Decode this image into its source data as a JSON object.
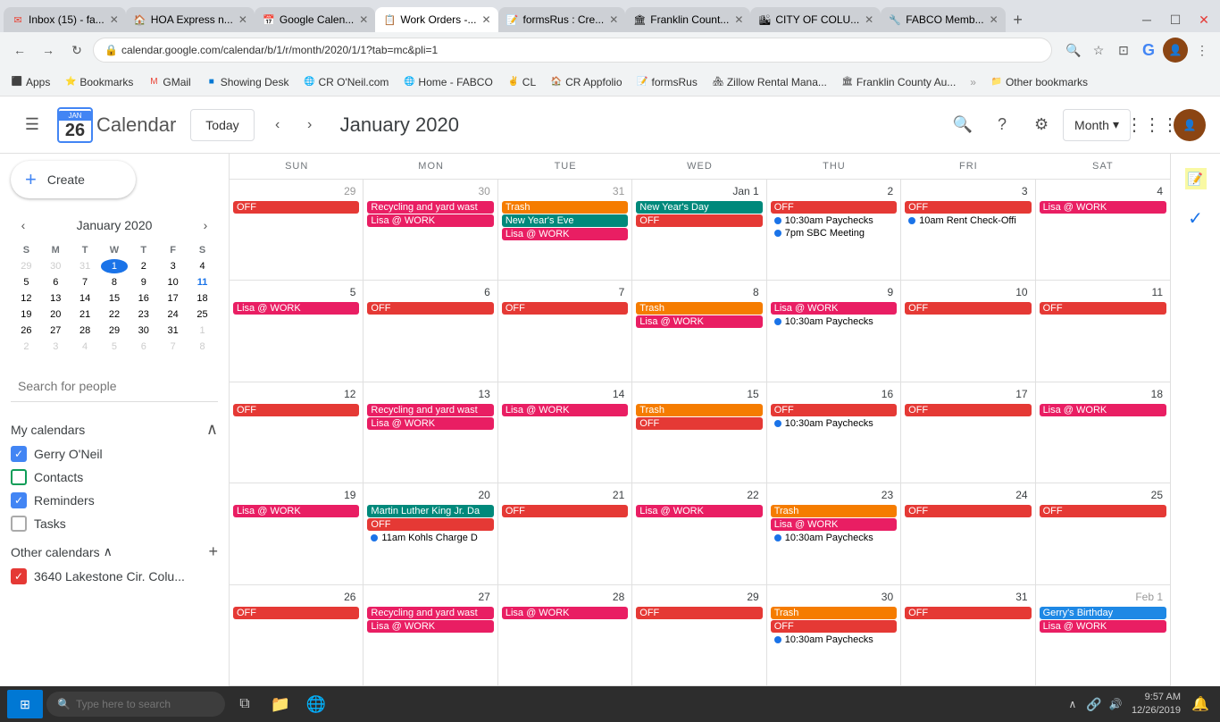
{
  "browser": {
    "tabs": [
      {
        "id": "gmail",
        "label": "Inbox (15) - fa...",
        "favicon": "✉",
        "active": false,
        "color": "#EA4335"
      },
      {
        "id": "hoa",
        "label": "HOA Express n...",
        "favicon": "🏠",
        "active": false
      },
      {
        "id": "gcal",
        "label": "Google Calen...",
        "favicon": "📅",
        "active": false
      },
      {
        "id": "workorders",
        "label": "Work Orders -...",
        "favicon": "📋",
        "active": true
      },
      {
        "id": "formsrus",
        "label": "formsRus : Cre...",
        "favicon": "📝",
        "active": false
      },
      {
        "id": "franklin1",
        "label": "Franklin Count...",
        "favicon": "🏛",
        "active": false
      },
      {
        "id": "cityofcolu",
        "label": "CITY OF COLU...",
        "favicon": "🏙",
        "active": false
      },
      {
        "id": "fabco",
        "label": "FABCO Memb...",
        "favicon": "🔧",
        "active": false
      }
    ],
    "address": "calendar.google.com/calendar/b/1/r/month/2020/1/1?tab=mc&pli=1",
    "bookmarks": [
      {
        "label": "Apps",
        "favicon": "⬛"
      },
      {
        "label": "Bookmarks",
        "favicon": "⭐"
      },
      {
        "label": "GMail",
        "favicon": "✉"
      },
      {
        "label": "Showing Desk",
        "favicon": "🟦"
      },
      {
        "label": "CR O'Neil.com",
        "favicon": "🌐"
      },
      {
        "label": "Home - FABCO",
        "favicon": "🌐"
      },
      {
        "label": "CL",
        "favicon": "✌"
      },
      {
        "label": "CR Appfolio",
        "favicon": "🏠"
      },
      {
        "label": "formsRus",
        "favicon": "📝"
      },
      {
        "label": "Zillow Rental Mana...",
        "favicon": "🏘"
      },
      {
        "label": "Franklin County Au...",
        "favicon": "🏛"
      },
      {
        "label": "Other bookmarks",
        "favicon": "📁"
      }
    ]
  },
  "header": {
    "logo_num": "26",
    "calendar_text": "Calendar",
    "today_label": "Today",
    "month_title": "January 2020",
    "view_label": "Month",
    "search_tooltip": "Search",
    "help_tooltip": "Help",
    "settings_tooltip": "Settings"
  },
  "sidebar": {
    "create_label": "Create",
    "mini_cal": {
      "title": "January 2020",
      "days_of_week": [
        "S",
        "M",
        "T",
        "W",
        "T",
        "F",
        "S"
      ],
      "weeks": [
        [
          {
            "num": "29",
            "other": true
          },
          {
            "num": "30",
            "other": true
          },
          {
            "num": "31",
            "other": true
          },
          {
            "num": "1",
            "today": true
          },
          {
            "num": "2"
          },
          {
            "num": "3"
          },
          {
            "num": "4"
          }
        ],
        [
          {
            "num": "5"
          },
          {
            "num": "6"
          },
          {
            "num": "7"
          },
          {
            "num": "8"
          },
          {
            "num": "9"
          },
          {
            "num": "10"
          },
          {
            "num": "11",
            "highlight": true
          }
        ],
        [
          {
            "num": "12"
          },
          {
            "num": "13"
          },
          {
            "num": "14"
          },
          {
            "num": "15"
          },
          {
            "num": "16"
          },
          {
            "num": "17"
          },
          {
            "num": "18"
          }
        ],
        [
          {
            "num": "19"
          },
          {
            "num": "20"
          },
          {
            "num": "21"
          },
          {
            "num": "22"
          },
          {
            "num": "23"
          },
          {
            "num": "24"
          },
          {
            "num": "25"
          }
        ],
        [
          {
            "num": "26"
          },
          {
            "num": "27"
          },
          {
            "num": "28"
          },
          {
            "num": "29"
          },
          {
            "num": "30"
          },
          {
            "num": "31"
          },
          {
            "num": "1",
            "other": true
          }
        ],
        [
          {
            "num": "2",
            "other": true
          },
          {
            "num": "3",
            "other": true
          },
          {
            "num": "4",
            "other": true
          },
          {
            "num": "5",
            "other": true
          },
          {
            "num": "6",
            "other": true
          },
          {
            "num": "7",
            "other": true
          },
          {
            "num": "8",
            "other": true
          }
        ]
      ]
    },
    "search_people_placeholder": "Search for people",
    "my_calendars_label": "My calendars",
    "my_calendars": [
      {
        "label": "Gerry O'Neil",
        "color": "#4285f4",
        "checked": true
      },
      {
        "label": "Contacts",
        "color": "#fff",
        "checked": false,
        "border": "#0f9d58"
      },
      {
        "label": "Reminders",
        "color": "#4285f4",
        "checked": true
      },
      {
        "label": "Tasks",
        "color": "#fff",
        "checked": false,
        "border": "#aaa"
      }
    ],
    "other_calendars_label": "Other calendars",
    "other_calendars": [
      {
        "label": "3640 Lakestone Cir. Colu...",
        "color": "#e53935",
        "checked": true
      }
    ]
  },
  "calendar": {
    "days_of_week": [
      "SUN",
      "MON",
      "TUE",
      "WED",
      "THU",
      "FRI",
      "SAT"
    ],
    "weeks": [
      {
        "days": [
          {
            "num": "29",
            "other": true,
            "events": [
              {
                "text": "OFF",
                "color": "red"
              }
            ]
          },
          {
            "num": "30",
            "other": true,
            "events": [
              {
                "text": "Recycling and yard wast",
                "color": "pink"
              },
              {
                "text": "Lisa @ WORK",
                "color": "pink"
              }
            ]
          },
          {
            "num": "31",
            "other": true,
            "events": [
              {
                "text": "Trash",
                "color": "orange"
              },
              {
                "text": "New Year's Eve",
                "color": "teal"
              },
              {
                "text": "Lisa @ WORK",
                "color": "pink"
              }
            ]
          },
          {
            "num": "Jan 1",
            "today": false,
            "events": [
              {
                "text": "New Year's Day",
                "color": "teal"
              }
            ]
          },
          {
            "num": "2",
            "events": [
              {
                "text": "OFF",
                "color": "red"
              },
              {
                "dot": true,
                "text": "10:30am Paychecks",
                "color": "blue"
              },
              {
                "dot": true,
                "text": "7pm SBC Meeting",
                "color": "blue"
              }
            ]
          },
          {
            "num": "3",
            "events": [
              {
                "text": "OFF",
                "color": "red"
              },
              {
                "dot": true,
                "text": "10am Rent Check-Offi",
                "color": "blue"
              }
            ]
          },
          {
            "num": "4",
            "events": [
              {
                "text": "Lisa @ WORK",
                "color": "pink"
              }
            ]
          }
        ]
      },
      {
        "days": [
          {
            "num": "5",
            "events": [
              {
                "text": "Lisa @ WORK",
                "color": "pink"
              }
            ]
          },
          {
            "num": "6",
            "events": [
              {
                "text": "OFF",
                "color": "red"
              }
            ]
          },
          {
            "num": "7",
            "events": [
              {
                "text": "OFF",
                "color": "red"
              }
            ]
          },
          {
            "num": "8",
            "events": [
              {
                "text": "Trash",
                "color": "orange"
              },
              {
                "text": "Lisa @ WORK",
                "color": "pink"
              }
            ]
          },
          {
            "num": "9",
            "events": [
              {
                "text": "Lisa @ WORK",
                "color": "pink"
              },
              {
                "dot": true,
                "text": "10:30am Paychecks",
                "color": "blue"
              }
            ]
          },
          {
            "num": "10",
            "events": [
              {
                "text": "OFF",
                "color": "red"
              }
            ]
          },
          {
            "num": "11",
            "events": [
              {
                "text": "OFF",
                "color": "red"
              }
            ]
          }
        ]
      },
      {
        "days": [
          {
            "num": "12",
            "events": [
              {
                "text": "OFF",
                "color": "red"
              }
            ]
          },
          {
            "num": "13",
            "events": [
              {
                "text": "Recycling and yard wast",
                "color": "pink"
              },
              {
                "text": "Lisa @ WORK",
                "color": "pink"
              }
            ]
          },
          {
            "num": "14",
            "events": [
              {
                "text": "Lisa @ WORK",
                "color": "pink"
              }
            ]
          },
          {
            "num": "15",
            "events": [
              {
                "text": "Trash",
                "color": "orange"
              },
              {
                "text": "OFF",
                "color": "red"
              }
            ]
          },
          {
            "num": "16",
            "events": [
              {
                "text": "OFF",
                "color": "red"
              },
              {
                "dot": true,
                "text": "10:30am Paychecks",
                "color": "blue"
              }
            ]
          },
          {
            "num": "17",
            "events": [
              {
                "text": "OFF",
                "color": "red"
              }
            ]
          },
          {
            "num": "18",
            "events": [
              {
                "text": "Lisa @ WORK",
                "color": "pink"
              }
            ]
          }
        ]
      },
      {
        "days": [
          {
            "num": "19",
            "events": [
              {
                "text": "Lisa @ WORK",
                "color": "pink"
              }
            ]
          },
          {
            "num": "20",
            "events": [
              {
                "text": "Martin Luther King Jr. Da",
                "color": "teal"
              },
              {
                "text": "OFF",
                "color": "red"
              },
              {
                "dot": true,
                "text": "11am Kohls Charge D",
                "color": "blue"
              }
            ]
          },
          {
            "num": "21",
            "events": [
              {
                "text": "OFF",
                "color": "red"
              }
            ]
          },
          {
            "num": "22",
            "events": [
              {
                "text": "Lisa @ WORK",
                "color": "pink"
              }
            ]
          },
          {
            "num": "23",
            "events": [
              {
                "text": "Trash",
                "color": "orange"
              },
              {
                "text": "Lisa @ WORK",
                "color": "pink"
              },
              {
                "dot": true,
                "text": "10:30am Paychecks",
                "color": "blue"
              }
            ]
          },
          {
            "num": "24",
            "events": [
              {
                "text": "OFF",
                "color": "red"
              }
            ]
          },
          {
            "num": "25",
            "events": [
              {
                "text": "OFF",
                "color": "red"
              }
            ]
          }
        ]
      },
      {
        "days": [
          {
            "num": "26",
            "events": [
              {
                "text": "OFF",
                "color": "red"
              }
            ]
          },
          {
            "num": "27",
            "events": [
              {
                "text": "Recycling and yard wast",
                "color": "pink"
              },
              {
                "text": "Lisa @ WORK",
                "color": "pink"
              }
            ]
          },
          {
            "num": "28",
            "events": [
              {
                "text": "Lisa @ WORK",
                "color": "pink"
              }
            ]
          },
          {
            "num": "29",
            "events": [
              {
                "text": "OFF",
                "color": "red"
              }
            ]
          },
          {
            "num": "30",
            "events": [
              {
                "text": "Trash",
                "color": "orange"
              },
              {
                "text": "OFF",
                "color": "red"
              },
              {
                "dot": true,
                "text": "10:30am Paychecks",
                "color": "blue"
              }
            ]
          },
          {
            "num": "31",
            "events": [
              {
                "text": "OFF",
                "color": "red"
              }
            ]
          },
          {
            "num": "Feb 1",
            "other": true,
            "events": [
              {
                "text": "Gerry's Birthday",
                "color": "blue"
              },
              {
                "text": "Lisa @ WORK",
                "color": "pink"
              }
            ]
          }
        ]
      }
    ]
  },
  "taskbar": {
    "search_placeholder": "Type here to search",
    "time": "9:57 AM",
    "date": "12/26/2019"
  },
  "side_panel": {
    "note_icon": "📝",
    "check_icon": "✓"
  },
  "colors": {
    "red": "#e53935",
    "pink": "#e91e63",
    "orange": "#f57c00",
    "teal": "#00897b",
    "blue": "#1e88e5",
    "green": "#43a047"
  }
}
